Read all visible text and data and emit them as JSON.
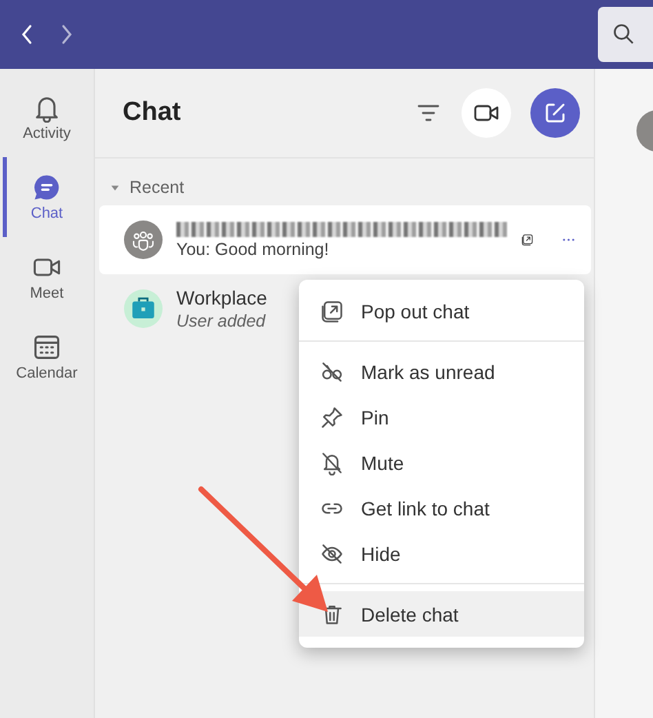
{
  "rail": {
    "items": [
      {
        "label": "Activity",
        "selected": false
      },
      {
        "label": "Chat",
        "selected": true
      },
      {
        "label": "Meet",
        "selected": false
      },
      {
        "label": "Calendar",
        "selected": false
      }
    ]
  },
  "chat_panel": {
    "title": "Chat",
    "section": "Recent",
    "expanded": true,
    "chats": [
      {
        "preview": "You: Good morning!",
        "selected": true
      },
      {
        "name": "Workplace",
        "preview": "User added",
        "selected": false
      }
    ]
  },
  "context_menu": {
    "sections": [
      [
        {
          "label": "Pop out chat",
          "highlighted": false
        }
      ],
      [
        {
          "label": "Mark as unread",
          "highlighted": false
        },
        {
          "label": "Pin",
          "highlighted": false
        },
        {
          "label": "Mute",
          "highlighted": false
        },
        {
          "label": "Get link to chat",
          "highlighted": false
        },
        {
          "label": "Hide",
          "highlighted": false
        }
      ],
      [
        {
          "label": "Delete chat",
          "highlighted": true
        }
      ]
    ]
  }
}
